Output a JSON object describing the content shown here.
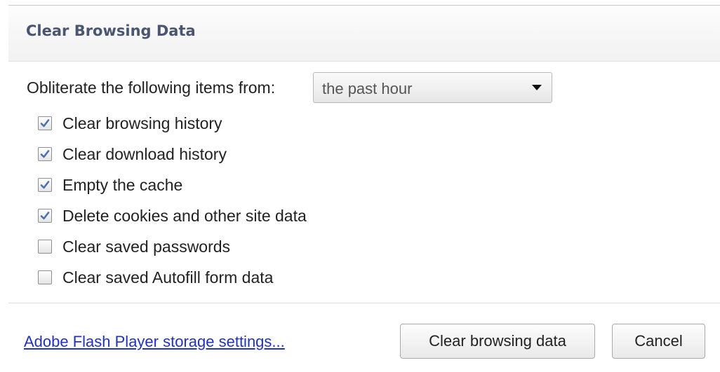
{
  "dialog": {
    "title": "Clear Browsing Data"
  },
  "time_range": {
    "label": "Obliterate the following items from:",
    "selected": "the past hour"
  },
  "options": [
    {
      "label": "Clear browsing history",
      "checked": true
    },
    {
      "label": "Clear download history",
      "checked": true
    },
    {
      "label": "Empty the cache",
      "checked": true
    },
    {
      "label": "Delete cookies and other site data",
      "checked": true
    },
    {
      "label": "Clear saved passwords",
      "checked": false
    },
    {
      "label": "Clear saved Autofill form data",
      "checked": false
    }
  ],
  "footer": {
    "flash_link": "Adobe Flash Player storage settings...",
    "clear_button": "Clear browsing data",
    "cancel_button": "Cancel"
  },
  "colors": {
    "title": "#4a5670",
    "link": "#2233bb",
    "checkmark": "#4f6fb5"
  }
}
